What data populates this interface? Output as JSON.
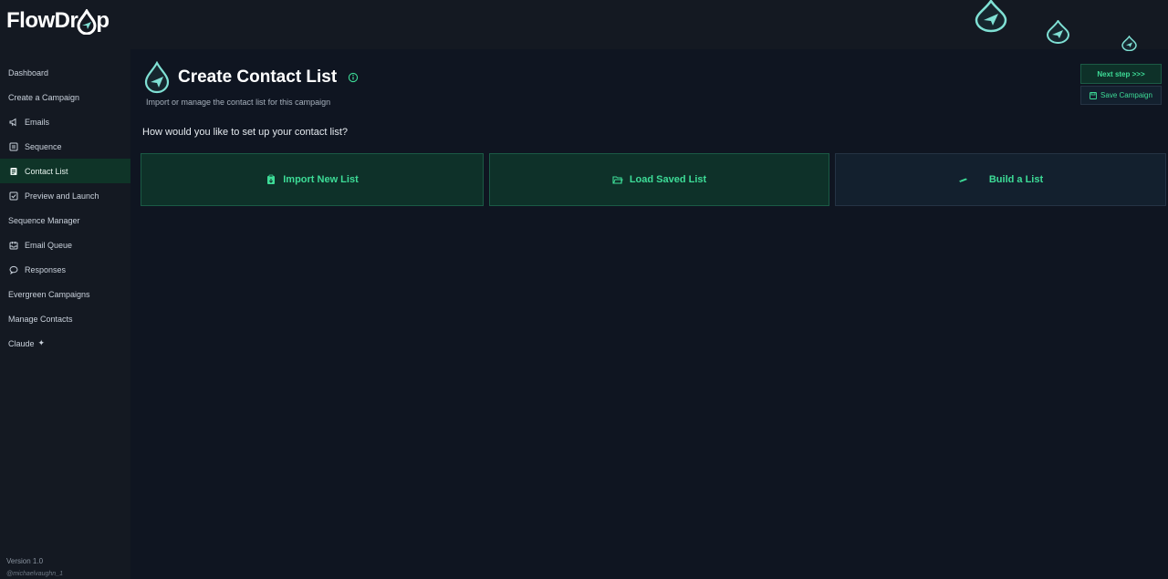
{
  "app": {
    "logo_prefix": "FlowDr",
    "logo_suffix": "p"
  },
  "colors": {
    "accent": "#3ddc97",
    "drop_accent": "#7fe0d4",
    "active_bg": "#0f3428",
    "bg": "#0f1521"
  },
  "sidebar": {
    "items": [
      {
        "label": "Dashboard",
        "icon": "none"
      },
      {
        "label": "Create a Campaign",
        "icon": "none"
      },
      {
        "label": "Emails",
        "icon": "megaphone-icon"
      },
      {
        "label": "Sequence",
        "icon": "list-icon"
      },
      {
        "label": "Contact List",
        "icon": "contact-list-icon",
        "active": true
      },
      {
        "label": "Preview and Launch",
        "icon": "checkbox-icon"
      },
      {
        "label": "Sequence Manager",
        "icon": "none"
      },
      {
        "label": "Email Queue",
        "icon": "inbox-icon"
      },
      {
        "label": "Responses",
        "icon": "chat-icon"
      },
      {
        "label": "Evergreen Campaigns",
        "icon": "none"
      },
      {
        "label": "Manage Contacts",
        "icon": "none"
      },
      {
        "label": "Claude",
        "icon": "sparkle-icon"
      }
    ],
    "sparkle": "✦",
    "version": "Version 1.0",
    "handle": "@michaelvaughn_1"
  },
  "main": {
    "title": "Create Contact List",
    "subtitle": "Import or manage the contact list for this campaign",
    "question": "How would you like to set up your contact list?",
    "options": [
      {
        "label": "Import New List",
        "icon": "clipboard-icon"
      },
      {
        "label": "Load Saved List",
        "icon": "folder-icon"
      },
      {
        "label": "Build a List",
        "icon": "pencil-icon"
      }
    ]
  },
  "actions": {
    "next_label": "Next step >>>",
    "save_label": "Save Campaign"
  }
}
